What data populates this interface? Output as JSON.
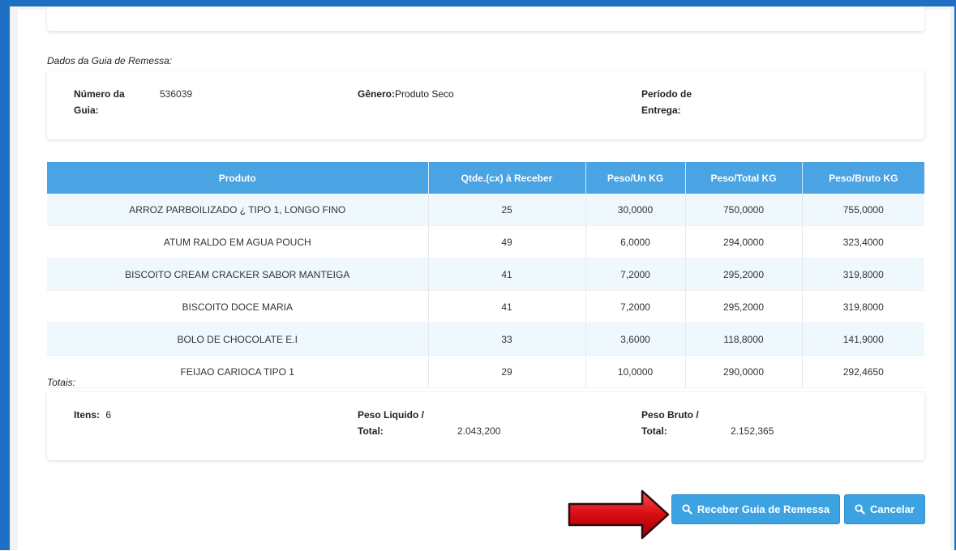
{
  "guia": {
    "section_title": "Dados da Guia de Remessa:",
    "numero_label_1": "Número da",
    "numero_label_2": "Guia:",
    "numero_value": "536039",
    "genero_label": "Gênero:",
    "genero_value": "Produto Seco",
    "periodo_label_1": "Período de",
    "periodo_label_2": "Entrega:"
  },
  "table": {
    "headers": [
      "Produto",
      "Qtde.(cx) à Receber",
      "Peso/Un KG",
      "Peso/Total KG",
      "Peso/Bruto KG"
    ],
    "rows": [
      [
        "ARROZ PARBOILIZADO ¿ TIPO 1, LONGO FINO",
        "25",
        "30,0000",
        "750,0000",
        "755,0000"
      ],
      [
        "ATUM RALDO EM AGUA POUCH",
        "49",
        "6,0000",
        "294,0000",
        "323,4000"
      ],
      [
        "BISCOITO CREAM CRACKER SABOR MANTEIGA",
        "41",
        "7,2000",
        "295,2000",
        "319,8000"
      ],
      [
        "BISCOITO DOCE MARIA",
        "41",
        "7,2000",
        "295,2000",
        "319,8000"
      ],
      [
        "BOLO DE CHOCOLATE E.I",
        "33",
        "3,6000",
        "118,8000",
        "141,9000"
      ],
      [
        "FEIJAO CARIOCA TIPO 1",
        "29",
        "10,0000",
        "290,0000",
        "292,4650"
      ]
    ]
  },
  "totais": {
    "section_title": "Totais:",
    "itens_label": "Itens:",
    "itens_value": "6",
    "peso_liquido_label_1": "Peso Liquido /",
    "peso_liquido_label_2": "Total:",
    "peso_liquido_value": "2.043,200",
    "peso_bruto_label_1": "Peso Bruto /",
    "peso_bruto_label_2": "Total:",
    "peso_bruto_value": "2.152,365"
  },
  "actions": {
    "receber_label": "Receber Guia de Remessa",
    "cancelar_label": "Cancelar",
    "button_icon": "search-icon",
    "pointer_icon": "red-arrow-icon"
  },
  "colors": {
    "frame": "#1f6fc4",
    "header": "#4aa3e3",
    "button": "#3da2e2",
    "arrow": "#e0141a"
  }
}
